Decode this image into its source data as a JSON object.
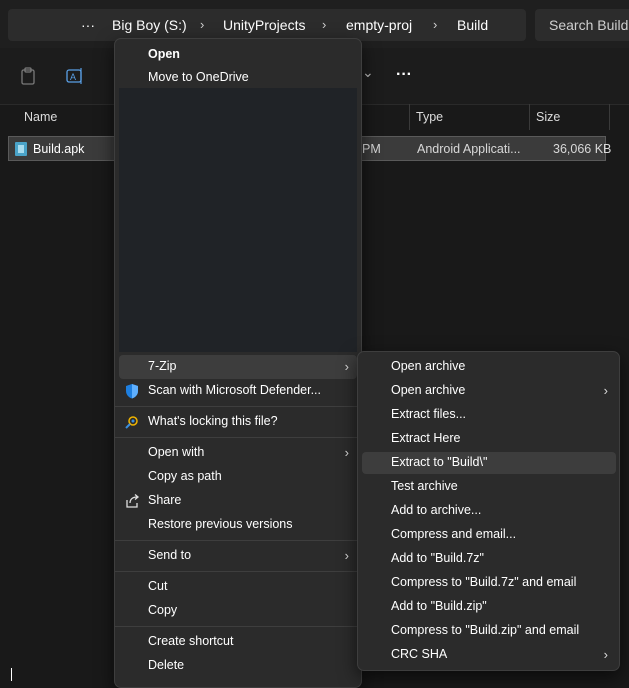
{
  "breadcrumb": {
    "more": "···",
    "items": [
      "Big Boy (S:)",
      "UnityProjects",
      "empty-proj",
      "Build"
    ]
  },
  "search": {
    "placeholder": "Search Build"
  },
  "toolbar": {
    "more": "···"
  },
  "columns": {
    "name": "Name",
    "type": "Type",
    "size": "Size"
  },
  "file": {
    "name": "Build.apk",
    "date_fragment": "PM",
    "type": "Android Applicati...",
    "size": "36,066 KB"
  },
  "context_menu": {
    "items": [
      "Open",
      "Move to OneDrive",
      "7-Zip",
      "Scan with Microsoft Defender...",
      "What's locking this file?",
      "Open with",
      "Copy as path",
      "Share",
      "Restore previous versions",
      "Send to",
      "Cut",
      "Copy",
      "Create shortcut",
      "Delete"
    ]
  },
  "submenu": {
    "title": "7-Zip",
    "items": [
      "Open archive",
      "Open archive",
      "Extract files...",
      "Extract Here",
      "Extract to \"Build\\\"",
      "Test archive",
      "Add to archive...",
      "Compress and email...",
      "Add to \"Build.7z\"",
      "Compress to \"Build.7z\" and email",
      "Add to \"Build.zip\"",
      "Compress to \"Build.zip\" and email",
      "CRC SHA"
    ]
  },
  "colors": {
    "menu_bg": "#2b2b2b",
    "highlight": "#3d3d3d",
    "defender_blue": "#1e7fe0"
  }
}
